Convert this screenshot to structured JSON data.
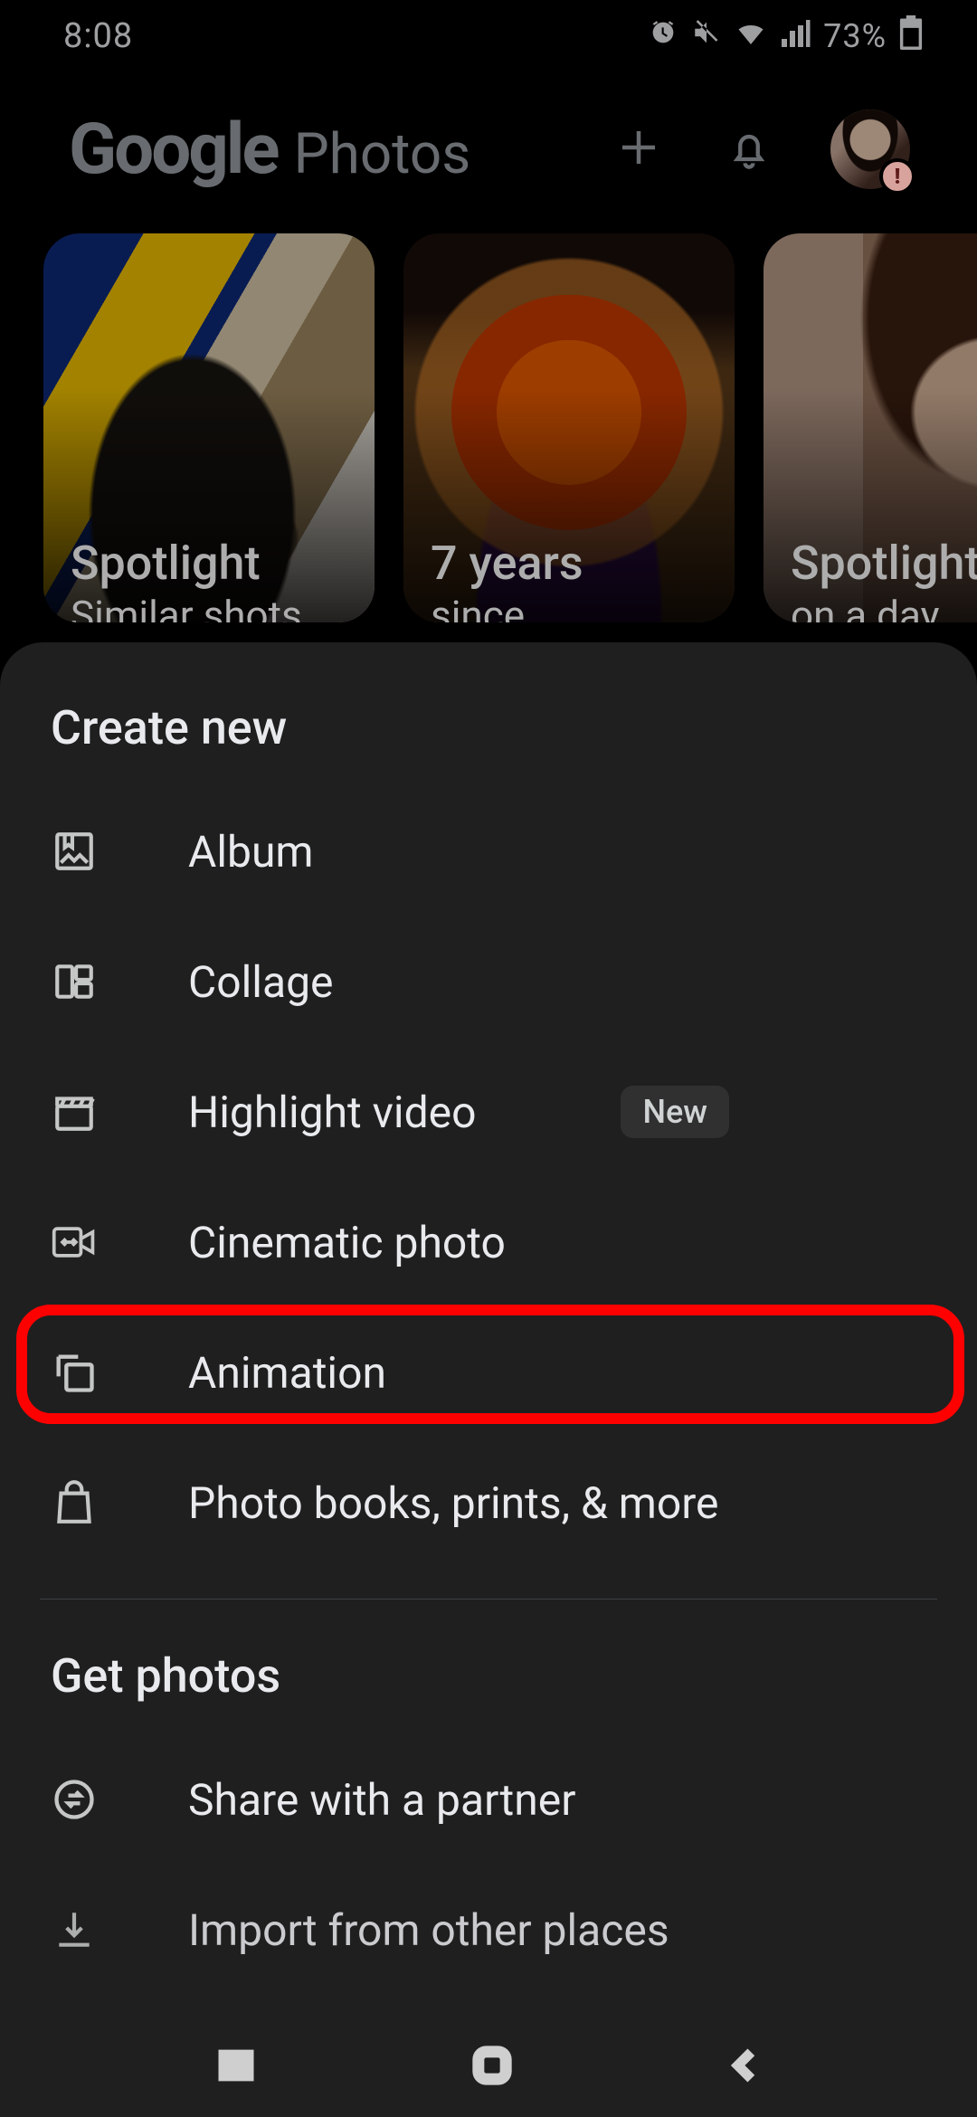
{
  "status": {
    "time": "8:08",
    "battery_percent": "73%"
  },
  "header": {
    "brand_word": "Google",
    "app_word": "Photos",
    "avatar_badge": "!"
  },
  "memories": [
    {
      "title": "Spotlight",
      "subtitle": "Similar shots"
    },
    {
      "title": "7 years",
      "subtitle": "since"
    },
    {
      "title": "Spotlight",
      "subtitle": "on a day"
    }
  ],
  "sheet": {
    "section1_title": "Create new",
    "items": [
      {
        "label": "Album",
        "badge": ""
      },
      {
        "label": "Collage",
        "badge": ""
      },
      {
        "label": "Highlight video",
        "badge": "New"
      },
      {
        "label": "Cinematic photo",
        "badge": ""
      },
      {
        "label": "Animation",
        "badge": ""
      },
      {
        "label": "Photo books, prints, & more",
        "badge": ""
      }
    ],
    "section2_title": "Get photos",
    "items2": [
      {
        "label": "Share with a partner"
      },
      {
        "label": "Import from other places"
      }
    ]
  }
}
